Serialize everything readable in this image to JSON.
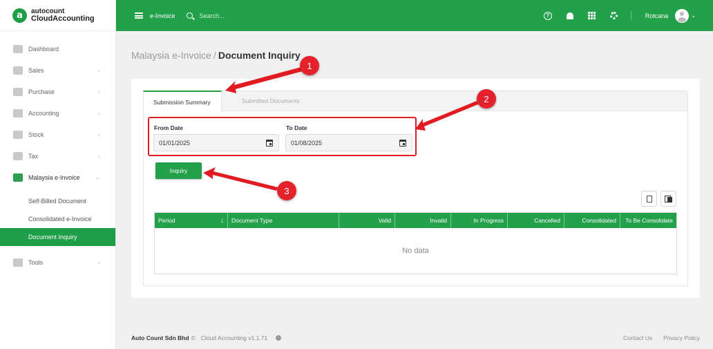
{
  "logo": {
    "line1": "autocount",
    "line2": "CloudAccounting",
    "mark": "a"
  },
  "sidebar": {
    "items": [
      {
        "label": "Dashboard",
        "icon": "dashboard-icon",
        "chevron": ""
      },
      {
        "label": "Sales",
        "icon": "sales-icon",
        "chevron": "‹"
      },
      {
        "label": "Purchase",
        "icon": "purchase-icon",
        "chevron": "‹"
      },
      {
        "label": "Accounting",
        "icon": "accounting-icon",
        "chevron": "‹"
      },
      {
        "label": "Stock",
        "icon": "stock-icon",
        "chevron": "‹"
      },
      {
        "label": "Tax",
        "icon": "tax-icon",
        "chevron": "‹"
      },
      {
        "label": "Malaysia e-Invoice",
        "icon": "einvoice-icon",
        "chevron": "⌄"
      },
      {
        "label": "Tools",
        "icon": "tools-icon",
        "chevron": "‹"
      }
    ],
    "subitems": [
      {
        "label": "Self-Billed Document"
      },
      {
        "label": "Consolidated e-Invoice"
      },
      {
        "label": "Document Inquiry"
      }
    ]
  },
  "topbar": {
    "module": "e-Invoice",
    "search_placeholder": "Search...",
    "help_glyph": "?",
    "username": "Rotcana",
    "avatar_chevron": "⌄"
  },
  "breadcrumb": {
    "parent": "Malaysia e-Invoice",
    "separator": "/",
    "current": "Document Inquiry"
  },
  "tabs": [
    {
      "label": "Submission Summary"
    },
    {
      "label": "Submitted Documents"
    }
  ],
  "form": {
    "from_label": "From Date",
    "from_value": "01/01/2025",
    "to_label": "To Date",
    "to_value": "01/08/2025",
    "inquiry_label": "Inquiry"
  },
  "table": {
    "columns": [
      "Period",
      "Document Type",
      "Valid",
      "Invalid",
      "In Progress",
      "Cancelled",
      "Consolidated",
      "To Be Consolidate"
    ],
    "sort_glyph": "↓",
    "empty_text": "No data"
  },
  "annotations": {
    "badge1": "1",
    "badge2": "2",
    "badge3": "3"
  },
  "footer": {
    "company": "Auto Count Sdn Bhd",
    "copyright": "©",
    "version": "Cloud Accounting v1.1.71",
    "contact": "Contact Us",
    "privacy": "Privacy Policy"
  },
  "colors": {
    "brand_green": "#22a04a",
    "annotation_red": "#e5222b"
  }
}
